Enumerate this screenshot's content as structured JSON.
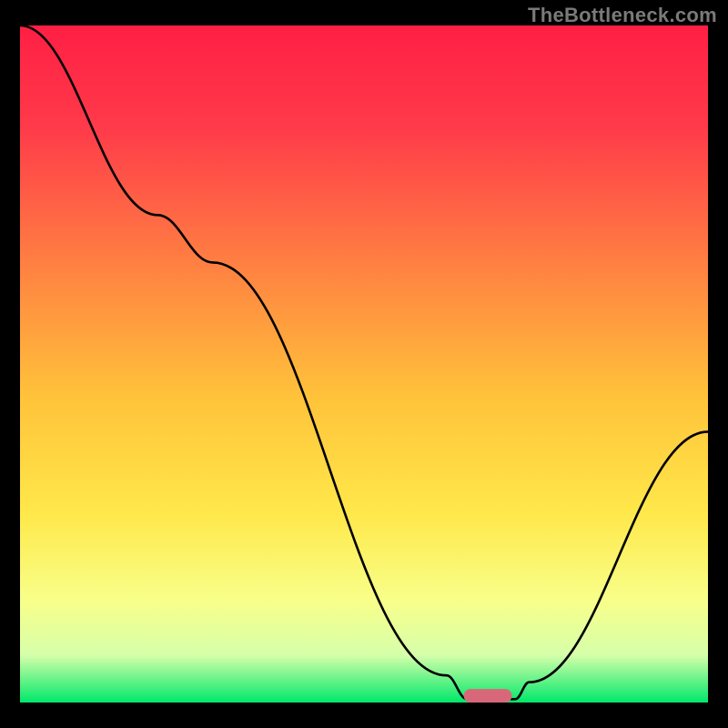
{
  "watermark": "TheBottleneck.com",
  "chart_data": {
    "type": "line",
    "title": "",
    "xlabel": "",
    "ylabel": "",
    "xlim": [
      0,
      100
    ],
    "ylim": [
      0,
      100
    ],
    "grid": false,
    "legend": false,
    "background_gradient": {
      "stops": [
        {
          "offset": 0.0,
          "color": "#ff1f44"
        },
        {
          "offset": 0.15,
          "color": "#ff3a4a"
        },
        {
          "offset": 0.35,
          "color": "#ff7f42"
        },
        {
          "offset": 0.55,
          "color": "#ffc33a"
        },
        {
          "offset": 0.72,
          "color": "#ffe84a"
        },
        {
          "offset": 0.85,
          "color": "#f8ff8a"
        },
        {
          "offset": 0.93,
          "color": "#d6ffaa"
        },
        {
          "offset": 1.0,
          "color": "#00e86a"
        }
      ]
    },
    "series": [
      {
        "name": "bottleneck-curve",
        "color": "#000000",
        "stroke_width": 2.6,
        "points": [
          {
            "x": 0,
            "y": 100
          },
          {
            "x": 20,
            "y": 72
          },
          {
            "x": 28,
            "y": 65
          },
          {
            "x": 62,
            "y": 4
          },
          {
            "x": 65,
            "y": 0.5
          },
          {
            "x": 72,
            "y": 0.5
          },
          {
            "x": 74,
            "y": 3
          },
          {
            "x": 100,
            "y": 40
          }
        ]
      }
    ],
    "marker": {
      "name": "optimal-range",
      "shape": "capsule",
      "fill": "#d9677a",
      "x_center": 68,
      "y": 0,
      "width": 7,
      "height": 2
    }
  }
}
